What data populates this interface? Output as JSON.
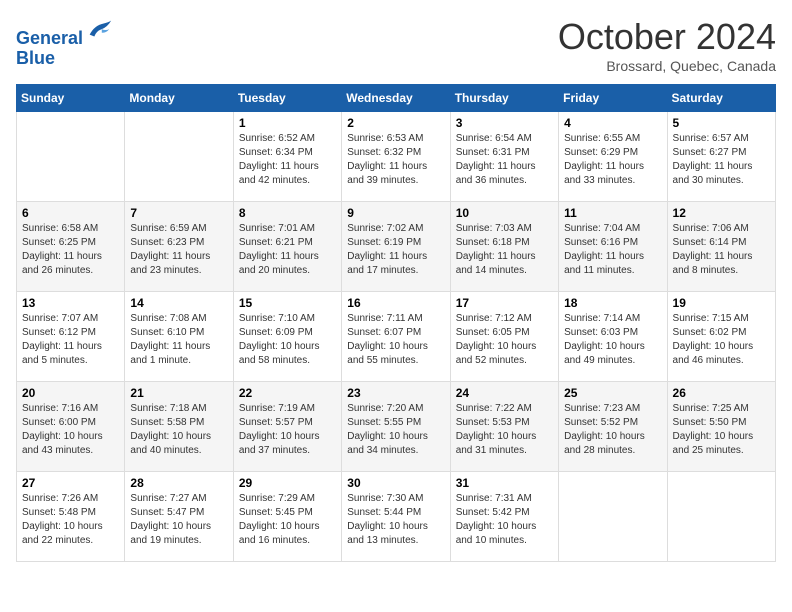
{
  "header": {
    "logo_line1": "General",
    "logo_line2": "Blue",
    "month": "October 2024",
    "location": "Brossard, Quebec, Canada"
  },
  "weekdays": [
    "Sunday",
    "Monday",
    "Tuesday",
    "Wednesday",
    "Thursday",
    "Friday",
    "Saturday"
  ],
  "weeks": [
    [
      {
        "day": "",
        "info": ""
      },
      {
        "day": "",
        "info": ""
      },
      {
        "day": "1",
        "info": "Sunrise: 6:52 AM\nSunset: 6:34 PM\nDaylight: 11 hours and 42 minutes."
      },
      {
        "day": "2",
        "info": "Sunrise: 6:53 AM\nSunset: 6:32 PM\nDaylight: 11 hours and 39 minutes."
      },
      {
        "day": "3",
        "info": "Sunrise: 6:54 AM\nSunset: 6:31 PM\nDaylight: 11 hours and 36 minutes."
      },
      {
        "day": "4",
        "info": "Sunrise: 6:55 AM\nSunset: 6:29 PM\nDaylight: 11 hours and 33 minutes."
      },
      {
        "day": "5",
        "info": "Sunrise: 6:57 AM\nSunset: 6:27 PM\nDaylight: 11 hours and 30 minutes."
      }
    ],
    [
      {
        "day": "6",
        "info": "Sunrise: 6:58 AM\nSunset: 6:25 PM\nDaylight: 11 hours and 26 minutes."
      },
      {
        "day": "7",
        "info": "Sunrise: 6:59 AM\nSunset: 6:23 PM\nDaylight: 11 hours and 23 minutes."
      },
      {
        "day": "8",
        "info": "Sunrise: 7:01 AM\nSunset: 6:21 PM\nDaylight: 11 hours and 20 minutes."
      },
      {
        "day": "9",
        "info": "Sunrise: 7:02 AM\nSunset: 6:19 PM\nDaylight: 11 hours and 17 minutes."
      },
      {
        "day": "10",
        "info": "Sunrise: 7:03 AM\nSunset: 6:18 PM\nDaylight: 11 hours and 14 minutes."
      },
      {
        "day": "11",
        "info": "Sunrise: 7:04 AM\nSunset: 6:16 PM\nDaylight: 11 hours and 11 minutes."
      },
      {
        "day": "12",
        "info": "Sunrise: 7:06 AM\nSunset: 6:14 PM\nDaylight: 11 hours and 8 minutes."
      }
    ],
    [
      {
        "day": "13",
        "info": "Sunrise: 7:07 AM\nSunset: 6:12 PM\nDaylight: 11 hours and 5 minutes."
      },
      {
        "day": "14",
        "info": "Sunrise: 7:08 AM\nSunset: 6:10 PM\nDaylight: 11 hours and 1 minute."
      },
      {
        "day": "15",
        "info": "Sunrise: 7:10 AM\nSunset: 6:09 PM\nDaylight: 10 hours and 58 minutes."
      },
      {
        "day": "16",
        "info": "Sunrise: 7:11 AM\nSunset: 6:07 PM\nDaylight: 10 hours and 55 minutes."
      },
      {
        "day": "17",
        "info": "Sunrise: 7:12 AM\nSunset: 6:05 PM\nDaylight: 10 hours and 52 minutes."
      },
      {
        "day": "18",
        "info": "Sunrise: 7:14 AM\nSunset: 6:03 PM\nDaylight: 10 hours and 49 minutes."
      },
      {
        "day": "19",
        "info": "Sunrise: 7:15 AM\nSunset: 6:02 PM\nDaylight: 10 hours and 46 minutes."
      }
    ],
    [
      {
        "day": "20",
        "info": "Sunrise: 7:16 AM\nSunset: 6:00 PM\nDaylight: 10 hours and 43 minutes."
      },
      {
        "day": "21",
        "info": "Sunrise: 7:18 AM\nSunset: 5:58 PM\nDaylight: 10 hours and 40 minutes."
      },
      {
        "day": "22",
        "info": "Sunrise: 7:19 AM\nSunset: 5:57 PM\nDaylight: 10 hours and 37 minutes."
      },
      {
        "day": "23",
        "info": "Sunrise: 7:20 AM\nSunset: 5:55 PM\nDaylight: 10 hours and 34 minutes."
      },
      {
        "day": "24",
        "info": "Sunrise: 7:22 AM\nSunset: 5:53 PM\nDaylight: 10 hours and 31 minutes."
      },
      {
        "day": "25",
        "info": "Sunrise: 7:23 AM\nSunset: 5:52 PM\nDaylight: 10 hours and 28 minutes."
      },
      {
        "day": "26",
        "info": "Sunrise: 7:25 AM\nSunset: 5:50 PM\nDaylight: 10 hours and 25 minutes."
      }
    ],
    [
      {
        "day": "27",
        "info": "Sunrise: 7:26 AM\nSunset: 5:48 PM\nDaylight: 10 hours and 22 minutes."
      },
      {
        "day": "28",
        "info": "Sunrise: 7:27 AM\nSunset: 5:47 PM\nDaylight: 10 hours and 19 minutes."
      },
      {
        "day": "29",
        "info": "Sunrise: 7:29 AM\nSunset: 5:45 PM\nDaylight: 10 hours and 16 minutes."
      },
      {
        "day": "30",
        "info": "Sunrise: 7:30 AM\nSunset: 5:44 PM\nDaylight: 10 hours and 13 minutes."
      },
      {
        "day": "31",
        "info": "Sunrise: 7:31 AM\nSunset: 5:42 PM\nDaylight: 10 hours and 10 minutes."
      },
      {
        "day": "",
        "info": ""
      },
      {
        "day": "",
        "info": ""
      }
    ]
  ]
}
